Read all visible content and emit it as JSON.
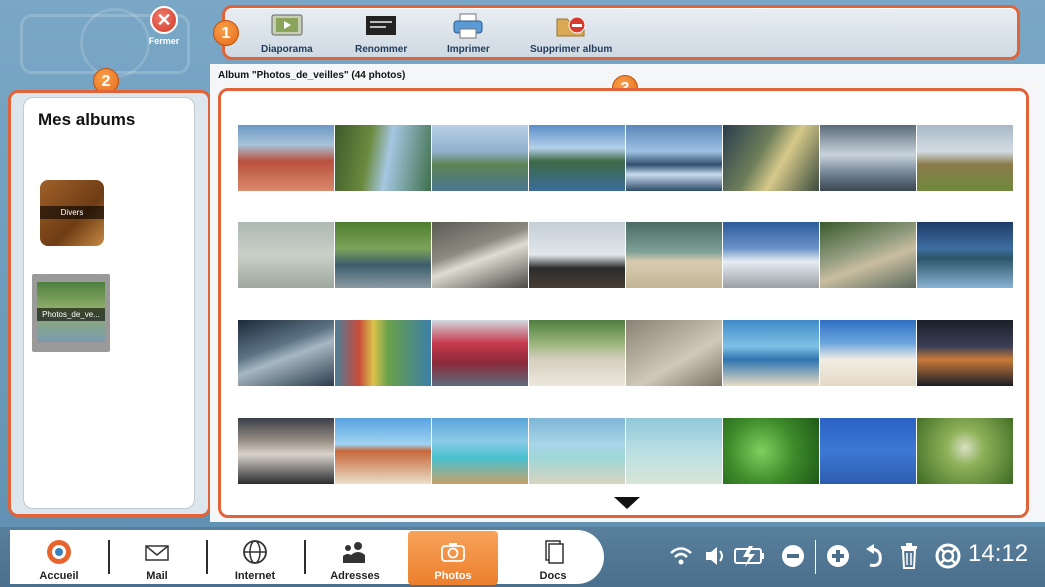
{
  "close": {
    "label": "Fermer"
  },
  "toolbar": {
    "items": [
      {
        "label": "Diaporama",
        "icon": "slideshow-icon"
      },
      {
        "label": "Renommer",
        "icon": "rename-icon"
      },
      {
        "label": "Imprimer",
        "icon": "printer-icon"
      },
      {
        "label": "Supprimer album",
        "icon": "delete-album-icon"
      }
    ]
  },
  "badges": [
    "1",
    "2",
    "3"
  ],
  "sidebar": {
    "title": "Mes albums",
    "albums": [
      {
        "label": "Divers"
      },
      {
        "label": "Photos_de_ve..."
      }
    ]
  },
  "main": {
    "caption": "Album \"Photos_de_veilles\" (44 photos)"
  },
  "taskbar": {
    "items": [
      {
        "label": "Accueil",
        "icon": "home-icon"
      },
      {
        "label": "Mail",
        "icon": "mail-icon"
      },
      {
        "label": "Internet",
        "icon": "globe-icon"
      },
      {
        "label": "Adresses",
        "icon": "contacts-icon"
      },
      {
        "label": "Photos",
        "icon": "camera-icon",
        "active": true
      },
      {
        "label": "Docs",
        "icon": "documents-icon"
      }
    ],
    "clock": "14:12"
  },
  "colors": {
    "accent": "#e0633a",
    "active": "#ec7f2d",
    "taskbar": "#4a6f8c"
  }
}
